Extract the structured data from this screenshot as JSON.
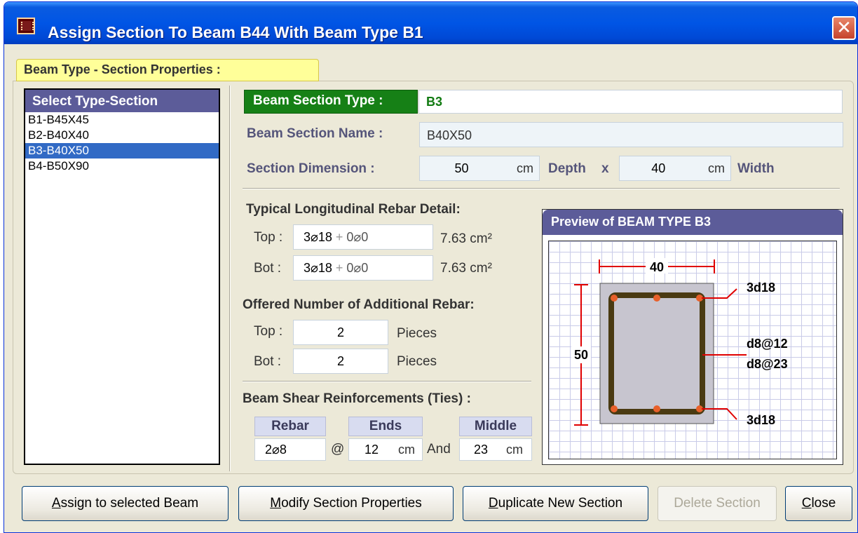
{
  "window": {
    "title": "Assign Section To Beam B44 With Beam Type B1",
    "close_glyph": "✕"
  },
  "tab": {
    "label": "Beam Type - Section Properties :"
  },
  "list": {
    "header": "Select  Type-Section",
    "items": [
      {
        "label": "B1-B45X45",
        "selected": false
      },
      {
        "label": "B2-B40X40",
        "selected": false
      },
      {
        "label": "B3-B40X50",
        "selected": true
      },
      {
        "label": "B4-B50X90",
        "selected": false
      }
    ]
  },
  "section": {
    "type_label": "Beam Section Type :",
    "type_value": "B3",
    "name_label": "Beam Section Name :",
    "name_value": "B40X50",
    "dimension_label": "Section Dimension :",
    "depth_value": "50",
    "depth_unit": "cm",
    "depth_label": "Depth",
    "times": "x",
    "width_value": "40",
    "width_unit": "cm",
    "width_label": "Width"
  },
  "longitudinal": {
    "heading": "Typical Longitudinal Rebar Detail:",
    "top_label": "Top :",
    "top_main": "3⌀18",
    "top_plus": "+",
    "top_extra": "0⌀0",
    "top_area": "7.63 cm²",
    "bot_label": "Bot :",
    "bot_main": "3⌀18",
    "bot_plus": "+",
    "bot_extra": "0⌀0",
    "bot_area": "7.63 cm²"
  },
  "additional": {
    "heading": "Offered Number of Additional Rebar:",
    "top_label": "Top :",
    "top_value": "2",
    "top_unit": "Pieces",
    "bot_label": "Bot :",
    "bot_value": "2",
    "bot_unit": "Pieces"
  },
  "shear": {
    "heading": "Beam Shear Reinforcements (Ties) :",
    "rebar_head": "Rebar",
    "rebar_value": "2⌀8",
    "at": "@",
    "ends_head": "Ends",
    "ends_value": "12",
    "ends_unit": "cm",
    "and": "And",
    "middle_head": "Middle",
    "middle_value": "23",
    "middle_unit": "cm"
  },
  "preview": {
    "title": "Preview of BEAM TYPE B3",
    "width_dim": "40",
    "height_dim": "50",
    "top_bars": "3d18",
    "ties_ends": "d8@12",
    "ties_middle": "d8@23",
    "bot_bars": "3d18",
    "colors": {
      "concrete": "#c7c5cf",
      "stirrup": "#4a3a12",
      "bar": "#e8602a",
      "dim": "#e00000"
    }
  },
  "buttons": [
    {
      "id": "assign",
      "underline": "A",
      "rest": "ssign to selected Beam",
      "enabled": true
    },
    {
      "id": "modify",
      "underline": "M",
      "rest": "odify Section Properties",
      "enabled": true
    },
    {
      "id": "duplicate",
      "underline": "D",
      "rest": "uplicate New Section",
      "enabled": true
    },
    {
      "id": "delete",
      "underline": "",
      "rest": "Delete Section",
      "enabled": false
    },
    {
      "id": "close",
      "underline": "C",
      "rest": "lose",
      "enabled": true
    }
  ]
}
